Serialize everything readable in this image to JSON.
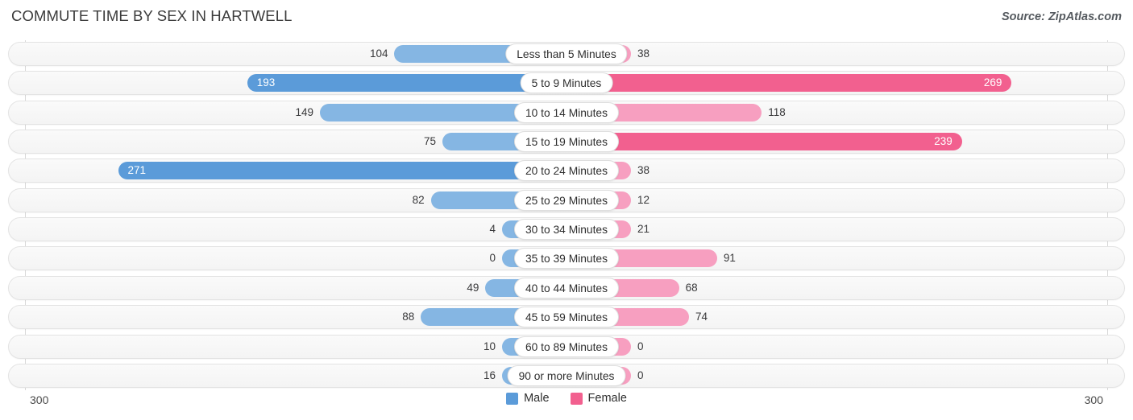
{
  "header": {
    "title": "COMMUTE TIME BY SEX IN HARTWELL",
    "source": "Source: ZipAtlas.com"
  },
  "axis": {
    "left_end": "300",
    "right_end": "300",
    "max": 300
  },
  "legend": [
    {
      "label": "Male",
      "color": "#5b9bd9"
    },
    {
      "label": "Female",
      "color": "#f2608f"
    }
  ],
  "colors": {
    "male_light": "#85b6e3",
    "male_dark": "#5b9bd9",
    "female_light": "#f79fc0",
    "female_dark": "#f2608f",
    "track": "#f6f6f6",
    "track_border": "#e3e3e3"
  },
  "chart_data": {
    "type": "bar",
    "title": "COMMUTE TIME BY SEX IN HARTWELL",
    "subtitle": "Source: ZipAtlas.com",
    "orientation": "horizontal",
    "layout": "diverging-bidirectional",
    "xlabel": "",
    "ylabel": "",
    "xlim": [
      300,
      300
    ],
    "grid": false,
    "legend_position": "bottom-center",
    "categories": [
      "Less than 5 Minutes",
      "5 to 9 Minutes",
      "10 to 14 Minutes",
      "15 to 19 Minutes",
      "20 to 24 Minutes",
      "25 to 29 Minutes",
      "30 to 34 Minutes",
      "35 to 39 Minutes",
      "40 to 44 Minutes",
      "45 to 59 Minutes",
      "60 to 89 Minutes",
      "90 or more Minutes"
    ],
    "series": [
      {
        "name": "Male",
        "direction": "left",
        "values": [
          104,
          193,
          149,
          75,
          271,
          82,
          4,
          0,
          49,
          88,
          10,
          16
        ]
      },
      {
        "name": "Female",
        "direction": "right",
        "values": [
          38,
          269,
          118,
          239,
          38,
          12,
          21,
          91,
          68,
          74,
          0,
          0
        ]
      }
    ]
  },
  "rows": [
    {
      "label": "Less than 5 Minutes",
      "male": "104",
      "female": "38"
    },
    {
      "label": "5 to 9 Minutes",
      "male": "193",
      "female": "269"
    },
    {
      "label": "10 to 14 Minutes",
      "male": "149",
      "female": "118"
    },
    {
      "label": "15 to 19 Minutes",
      "male": "75",
      "female": "239"
    },
    {
      "label": "20 to 24 Minutes",
      "male": "271",
      "female": "38"
    },
    {
      "label": "25 to 29 Minutes",
      "male": "82",
      "female": "12"
    },
    {
      "label": "30 to 34 Minutes",
      "male": "4",
      "female": "21"
    },
    {
      "label": "35 to 39 Minutes",
      "male": "0",
      "female": "91"
    },
    {
      "label": "40 to 44 Minutes",
      "male": "49",
      "female": "68"
    },
    {
      "label": "45 to 59 Minutes",
      "male": "88",
      "female": "74"
    },
    {
      "label": "60 to 89 Minutes",
      "male": "10",
      "female": "0"
    },
    {
      "label": "90 or more Minutes",
      "male": "16",
      "female": "0"
    }
  ]
}
